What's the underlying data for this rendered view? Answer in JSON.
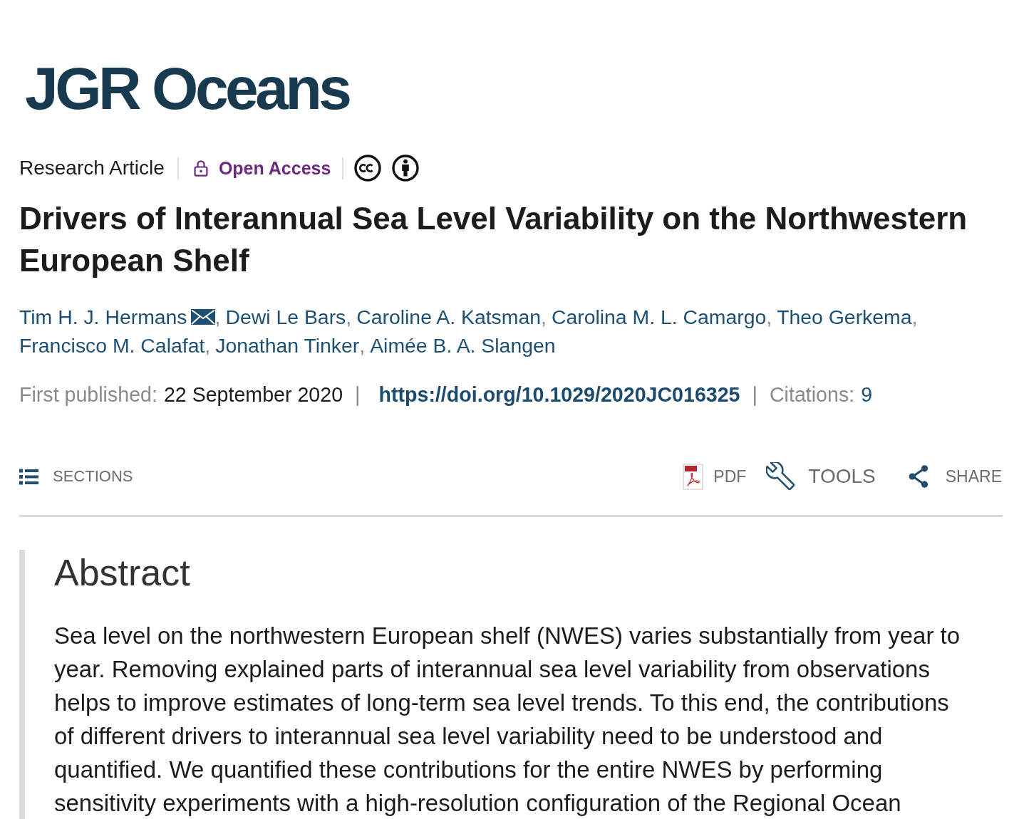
{
  "logo": {
    "text": "JGR Oceans"
  },
  "article_meta": {
    "type": "Research Article",
    "access_label": "Open Access"
  },
  "title": "Drivers of Interannual Sea Level Variability on the Northwestern European Shelf",
  "authors": [
    {
      "name": "Tim H. J. Hermans",
      "corresponding": true,
      "separator": ","
    },
    {
      "name": "Dewi Le Bars",
      "corresponding": false,
      "separator": ","
    },
    {
      "name": "Caroline A. Katsman",
      "corresponding": false,
      "separator": ","
    },
    {
      "name": "Carolina M. L. Camargo",
      "corresponding": false,
      "separator": ","
    },
    {
      "name": "Theo Gerkema",
      "corresponding": false,
      "separator": ","
    },
    {
      "name": "Francisco M. Calafat",
      "corresponding": false,
      "separator": ","
    },
    {
      "name": "Jonathan Tinker",
      "corresponding": false,
      "separator": ","
    },
    {
      "name": "Aimée B. A. Slangen",
      "corresponding": false
    }
  ],
  "publication": {
    "first_published_label": "First published:",
    "date": "22 September 2020",
    "separators": [
      "|",
      "|"
    ],
    "doi": "https://doi.org/10.1029/2020JC016325",
    "citations_label": "Citations:",
    "citations": "9"
  },
  "toolbar": {
    "sections_label": "SECTIONS",
    "actions": [
      {
        "kind": "pdf",
        "label": "PDF"
      },
      {
        "kind": "tools",
        "label": "TOOLS"
      },
      {
        "kind": "share",
        "label": "SHARE"
      }
    ]
  },
  "abstract": {
    "heading": "Abstract",
    "text": "Sea level on the northwestern European shelf (NWES) varies substantially from year to year. Removing explained parts of interannual sea level variability from observations helps to improve estimates of long-term sea level trends. To this end, the contributions of different drivers to interannual sea level variability need to be understood and quantified. We quantified these contributions for the entire NWES by performing sensitivity experiments with a high-resolution configuration of the Regional Ocean"
  }
}
